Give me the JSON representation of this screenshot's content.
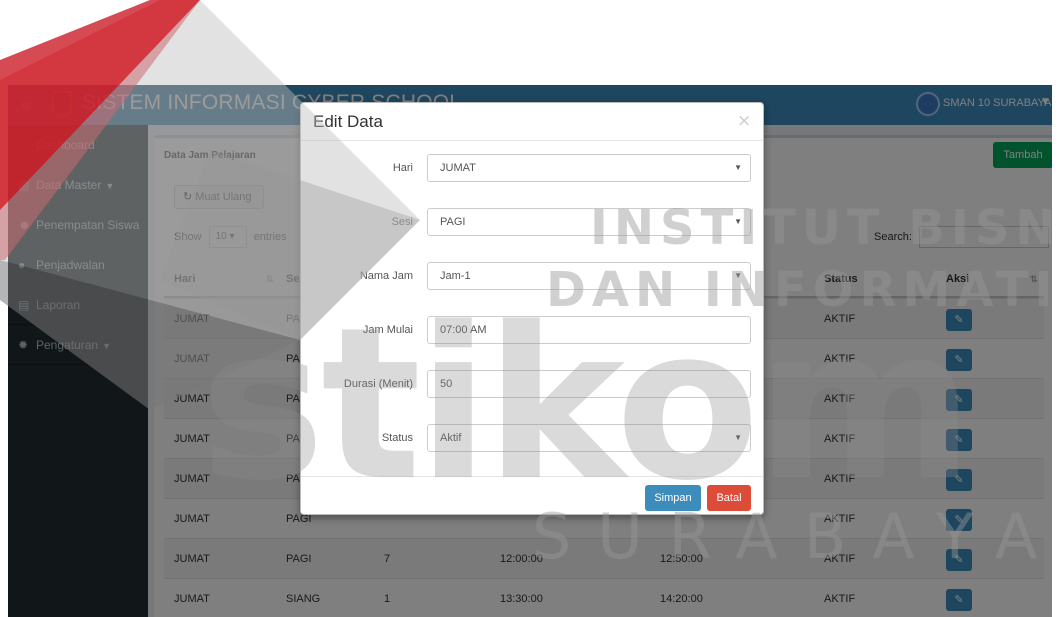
{
  "app": {
    "title": "SISTEM INFORMASI CYBER SCHOOL",
    "user_name": "SMAN 10 SURABAYA"
  },
  "sidebar": {
    "items": [
      {
        "label": "Dashboard",
        "icon": "home-icon"
      },
      {
        "label": "Data Master",
        "icon": "file-icon",
        "has_caret": true
      },
      {
        "label": "Penempatan Siswa",
        "icon": "users-icon"
      },
      {
        "label": "Penjadwalan",
        "icon": "calendar-icon"
      },
      {
        "label": "Laporan",
        "icon": "report-icon"
      },
      {
        "label": "Pengaturan",
        "icon": "gear-icon",
        "has_caret": true
      }
    ]
  },
  "content": {
    "box_title": "Data Jam Pelajaran",
    "add_label": "Tambah",
    "reload_label": "Muat Ulang",
    "show_label": "Show",
    "entries_value": "10",
    "entries_label": "entries",
    "search_label": "Search:"
  },
  "table": {
    "headers": {
      "hari": "Hari",
      "sesi": "Sesi",
      "status": "Status",
      "aksi": "Aksi"
    },
    "rows": [
      {
        "hari": "JUMAT",
        "sesi": "PAGI",
        "jam": "",
        "mulai": "",
        "selesai": "",
        "status": "AKTIF"
      },
      {
        "hari": "JUMAT",
        "sesi": "PAGI",
        "jam": "",
        "mulai": "",
        "selesai": "",
        "status": "AKTIF"
      },
      {
        "hari": "JUMAT",
        "sesi": "PAGI",
        "jam": "",
        "mulai": "",
        "selesai": "",
        "status": "AKTIF"
      },
      {
        "hari": "JUMAT",
        "sesi": "PAGI",
        "jam": "",
        "mulai": "",
        "selesai": "",
        "status": "AKTIF"
      },
      {
        "hari": "JUMAT",
        "sesi": "PAGI",
        "jam": "",
        "mulai": "",
        "selesai": "",
        "status": "AKTIF"
      },
      {
        "hari": "JUMAT",
        "sesi": "PAGI",
        "jam": "",
        "mulai": "",
        "selesai": "",
        "status": "AKTIF"
      },
      {
        "hari": "JUMAT",
        "sesi": "PAGI",
        "jam": "7",
        "mulai": "12:00:00",
        "selesai": "12:50:00",
        "status": "AKTIF"
      },
      {
        "hari": "JUMAT",
        "sesi": "SIANG",
        "jam": "1",
        "mulai": "13:30:00",
        "selesai": "14:20:00",
        "status": "AKTIF"
      }
    ]
  },
  "modal": {
    "title": "Edit Data",
    "close_glyph": "×",
    "fields": [
      {
        "label": "Hari",
        "value": "JUMAT",
        "type": "select"
      },
      {
        "label": "Sesi",
        "value": "PAGI",
        "type": "select"
      },
      {
        "label": "Nama Jam",
        "value": "Jam-1",
        "type": "select"
      },
      {
        "label": "Jam Mulai",
        "value": "07:00 AM",
        "type": "input"
      },
      {
        "label": "Durasi (Menit)",
        "value": "50",
        "type": "input"
      },
      {
        "label": "Status",
        "value": "Aktif",
        "type": "select"
      }
    ],
    "save_label": "Simpan",
    "cancel_label": "Batal"
  },
  "watermark": {
    "line1": "INSTITUT BISNIS",
    "line2": "DAN INFORMATIKA",
    "brand": "stikom",
    "city": "SURABAYA",
    "colors": {
      "logo_red": "#d21f26",
      "logo_gray": "#8a8a8a"
    }
  },
  "theme": {
    "header": "#3c8dbc",
    "sidebar": "#222d32",
    "success": "#00a65a",
    "danger": "#dd4b39",
    "primary": "#3c8dbc"
  }
}
